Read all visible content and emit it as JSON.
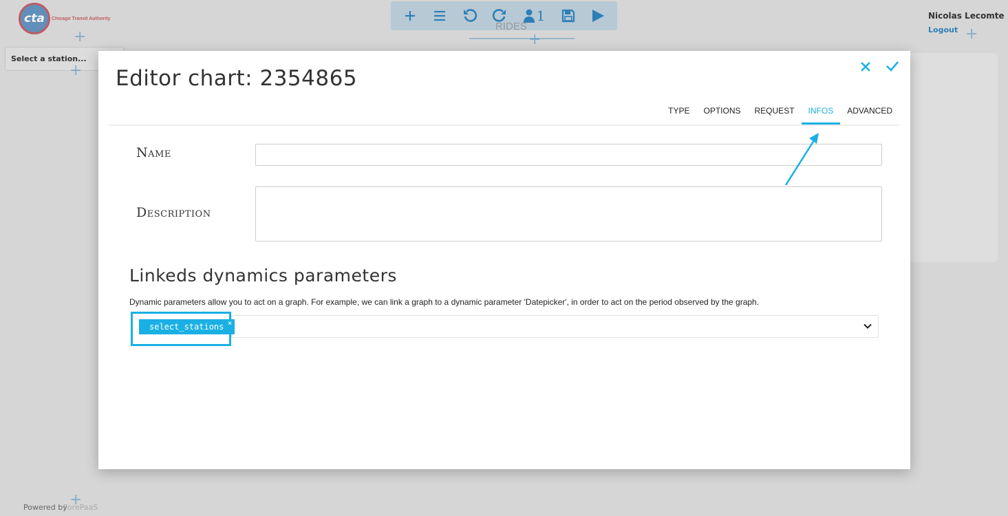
{
  "app": {
    "logo_text": "cta",
    "logo_caption": "Chicago Transit Authority",
    "station_select_label": "Select a station...",
    "dashboard_title": "RIDES",
    "toolbar": {
      "icons": [
        "plus-icon",
        "menu-icon",
        "undo-icon",
        "redo-icon",
        "user-icon",
        "save-icon",
        "play-icon"
      ],
      "user_count": "1"
    },
    "user": {
      "name": "Nicolas Lecomte",
      "logout_label": "Logout"
    },
    "footer": {
      "powered_label": "Powered by",
      "brand": "ForePaaS"
    }
  },
  "modal": {
    "title": "Editor chart: 2354865",
    "tabs": [
      {
        "label": "TYPE"
      },
      {
        "label": "OPTIONS"
      },
      {
        "label": "REQUEST"
      },
      {
        "label": "INFOS"
      },
      {
        "label": "ADVANCED"
      }
    ],
    "active_tab": "INFOS",
    "form": {
      "name_label": "Name",
      "name_value": "",
      "description_label": "Description",
      "description_value": ""
    },
    "linked": {
      "title": "Linkeds dynamics parameters",
      "description": "Dynamic parameters allow you to act on a graph. For example, we can link a graph to a dynamic parameter 'Datepicker', in order to act on the period observed by the graph.",
      "selected": [
        {
          "label": "select_stations",
          "remove": "×"
        }
      ]
    }
  },
  "colors": {
    "accent": "#1ab0e4",
    "brand_blue": "#2c7fb8",
    "overlay": "#d6d6d6"
  }
}
